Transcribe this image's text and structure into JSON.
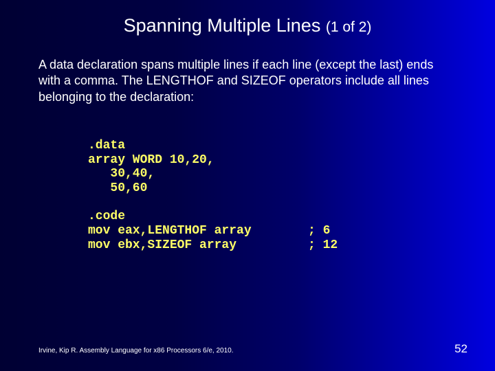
{
  "title": {
    "main": "Spanning Multiple Lines ",
    "sub": "(1 of 2)"
  },
  "paragraph": "A data declaration spans multiple lines if each line (except the last) ends with a comma. The LENGTHOF and SIZEOF operators include all lines belonging to the declaration:",
  "code": {
    "lines": [
      ".data",
      "array WORD 10,20,",
      "   30,40,",
      "   50,60",
      "",
      ".code"
    ],
    "rows": [
      {
        "left": "mov eax,LENGTHOF array",
        "right": "; 6"
      },
      {
        "left": "mov ebx,SIZEOF array",
        "right": "; 12"
      }
    ]
  },
  "footer": "Irvine, Kip R. Assembly Language for x86 Processors 6/e, 2010.",
  "page": "52"
}
